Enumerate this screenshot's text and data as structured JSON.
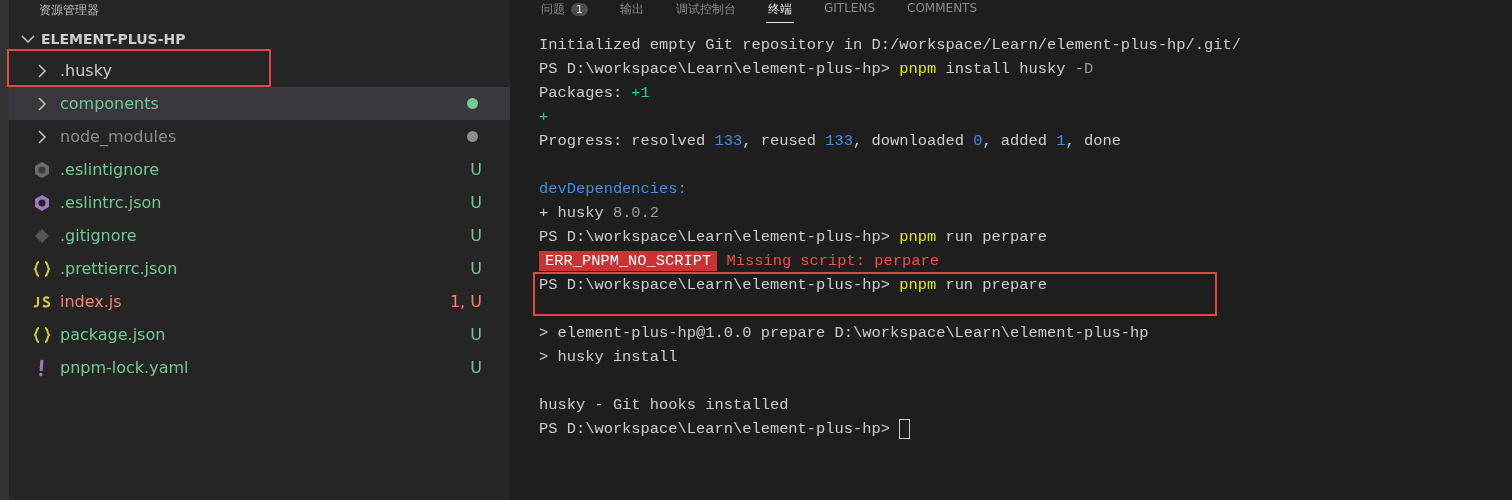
{
  "sidebar": {
    "title": "资源管理器",
    "root": {
      "label": "ELEMENT-PLUS-HP",
      "expanded": true
    },
    "items": [
      {
        "kind": "folder",
        "name": ".husky",
        "color": "#cccccc",
        "selected": false,
        "highlighted": true
      },
      {
        "kind": "folder",
        "name": "components",
        "color": "#73c991",
        "dot": true,
        "selected": true
      },
      {
        "kind": "folder",
        "name": "node_modules",
        "color": "#8c8c8c",
        "dot": true,
        "selected": false
      },
      {
        "kind": "eslintignore",
        "name": ".eslintignore",
        "color": "#73c991",
        "badge": "U",
        "selected": false
      },
      {
        "kind": "eslint",
        "name": ".eslintrc.json",
        "color": "#73c991",
        "badge": "U",
        "selected": false
      },
      {
        "kind": "git",
        "name": ".gitignore",
        "color": "#73c991",
        "badge": "U",
        "selected": false
      },
      {
        "kind": "json",
        "name": ".prettierrc.json",
        "color": "#73c991",
        "badge": "U",
        "selected": false
      },
      {
        "kind": "js",
        "name": "index.js",
        "color": "#f88070",
        "badge": "1, U",
        "selected": false
      },
      {
        "kind": "json",
        "name": "package.json",
        "color": "#73c991",
        "badge": "U",
        "selected": false
      },
      {
        "kind": "yaml",
        "name": "pnpm-lock.yaml",
        "color": "#73c991",
        "badge": "U",
        "selected": false
      }
    ]
  },
  "panel": {
    "tabs": [
      {
        "label": "问题",
        "count": "1",
        "selected": false
      },
      {
        "label": "输出",
        "selected": false
      },
      {
        "label": "调试控制台",
        "selected": false
      },
      {
        "label": "终端",
        "selected": true
      },
      {
        "label": "GITLENS",
        "selected": false
      },
      {
        "label": "COMMENTS",
        "selected": false
      }
    ],
    "terminal": [
      {
        "kind": "output",
        "segments": [
          {
            "kind": "text",
            "text": "Initialized empty Git repository in D:/workspace/Learn/element-plus-hp/.git/"
          }
        ]
      },
      {
        "kind": "output",
        "segments": [
          {
            "kind": "text",
            "text": "PS D:\\workspace\\Learn\\element-plus-hp> "
          },
          {
            "kind": "command",
            "text": "pnpm"
          },
          {
            "kind": "text",
            "text": " install husky "
          },
          {
            "kind": "muted",
            "text": "-D"
          }
        ]
      },
      {
        "kind": "output",
        "segments": [
          {
            "kind": "text",
            "text": "Packages: "
          },
          {
            "kind": "added",
            "text": "+1"
          }
        ]
      },
      {
        "kind": "output",
        "segments": [
          {
            "kind": "added",
            "text": "+"
          }
        ]
      },
      {
        "kind": "output",
        "segments": [
          {
            "kind": "text",
            "text": "Progress: resolved "
          },
          {
            "kind": "number",
            "text": "133"
          },
          {
            "kind": "text",
            "text": ", reused "
          },
          {
            "kind": "number",
            "text": "133"
          },
          {
            "kind": "text",
            "text": ", downloaded "
          },
          {
            "kind": "number",
            "text": "0"
          },
          {
            "kind": "text",
            "text": ", added "
          },
          {
            "kind": "number",
            "text": "1"
          },
          {
            "kind": "text",
            "text": ", done"
          }
        ]
      },
      {
        "kind": "blank"
      },
      {
        "kind": "output",
        "segments": [
          {
            "kind": "heading",
            "text": "devDependencies:"
          }
        ]
      },
      {
        "kind": "output",
        "segments": [
          {
            "kind": "text",
            "text": "+ husky "
          },
          {
            "kind": "muted",
            "text": "8.0.2"
          }
        ]
      },
      {
        "kind": "output",
        "segments": [
          {
            "kind": "text",
            "text": "PS D:\\workspace\\Learn\\element-plus-hp> "
          },
          {
            "kind": "command",
            "text": "pnpm"
          },
          {
            "kind": "text",
            "text": " run perpare"
          }
        ]
      },
      {
        "kind": "output",
        "segments": [
          {
            "kind": "error-badge",
            "text": "ERR_PNPM_NO_SCRIPT"
          },
          {
            "kind": "error",
            "text": " Missing script: perpare"
          }
        ]
      },
      {
        "kind": "highlighted",
        "segments": [
          {
            "kind": "text",
            "text": "PS D:\\workspace\\Learn\\element-plus-hp> "
          },
          {
            "kind": "command",
            "text": "pnpm"
          },
          {
            "kind": "text",
            "text": " run prepare"
          }
        ]
      },
      {
        "kind": "blank"
      },
      {
        "kind": "output",
        "segments": [
          {
            "kind": "text",
            "text": "> element-plus-hp@1.0.0 prepare D:\\workspace\\Learn\\element-plus-hp"
          }
        ]
      },
      {
        "kind": "output",
        "segments": [
          {
            "kind": "text",
            "text": "> husky install"
          }
        ]
      },
      {
        "kind": "blank"
      },
      {
        "kind": "output",
        "segments": [
          {
            "kind": "text",
            "text": "husky - Git hooks installed"
          }
        ]
      },
      {
        "kind": "output",
        "segments": [
          {
            "kind": "text",
            "text": "PS D:\\workspace\\Learn\\element-plus-hp> "
          },
          {
            "kind": "cursor"
          }
        ]
      }
    ]
  }
}
